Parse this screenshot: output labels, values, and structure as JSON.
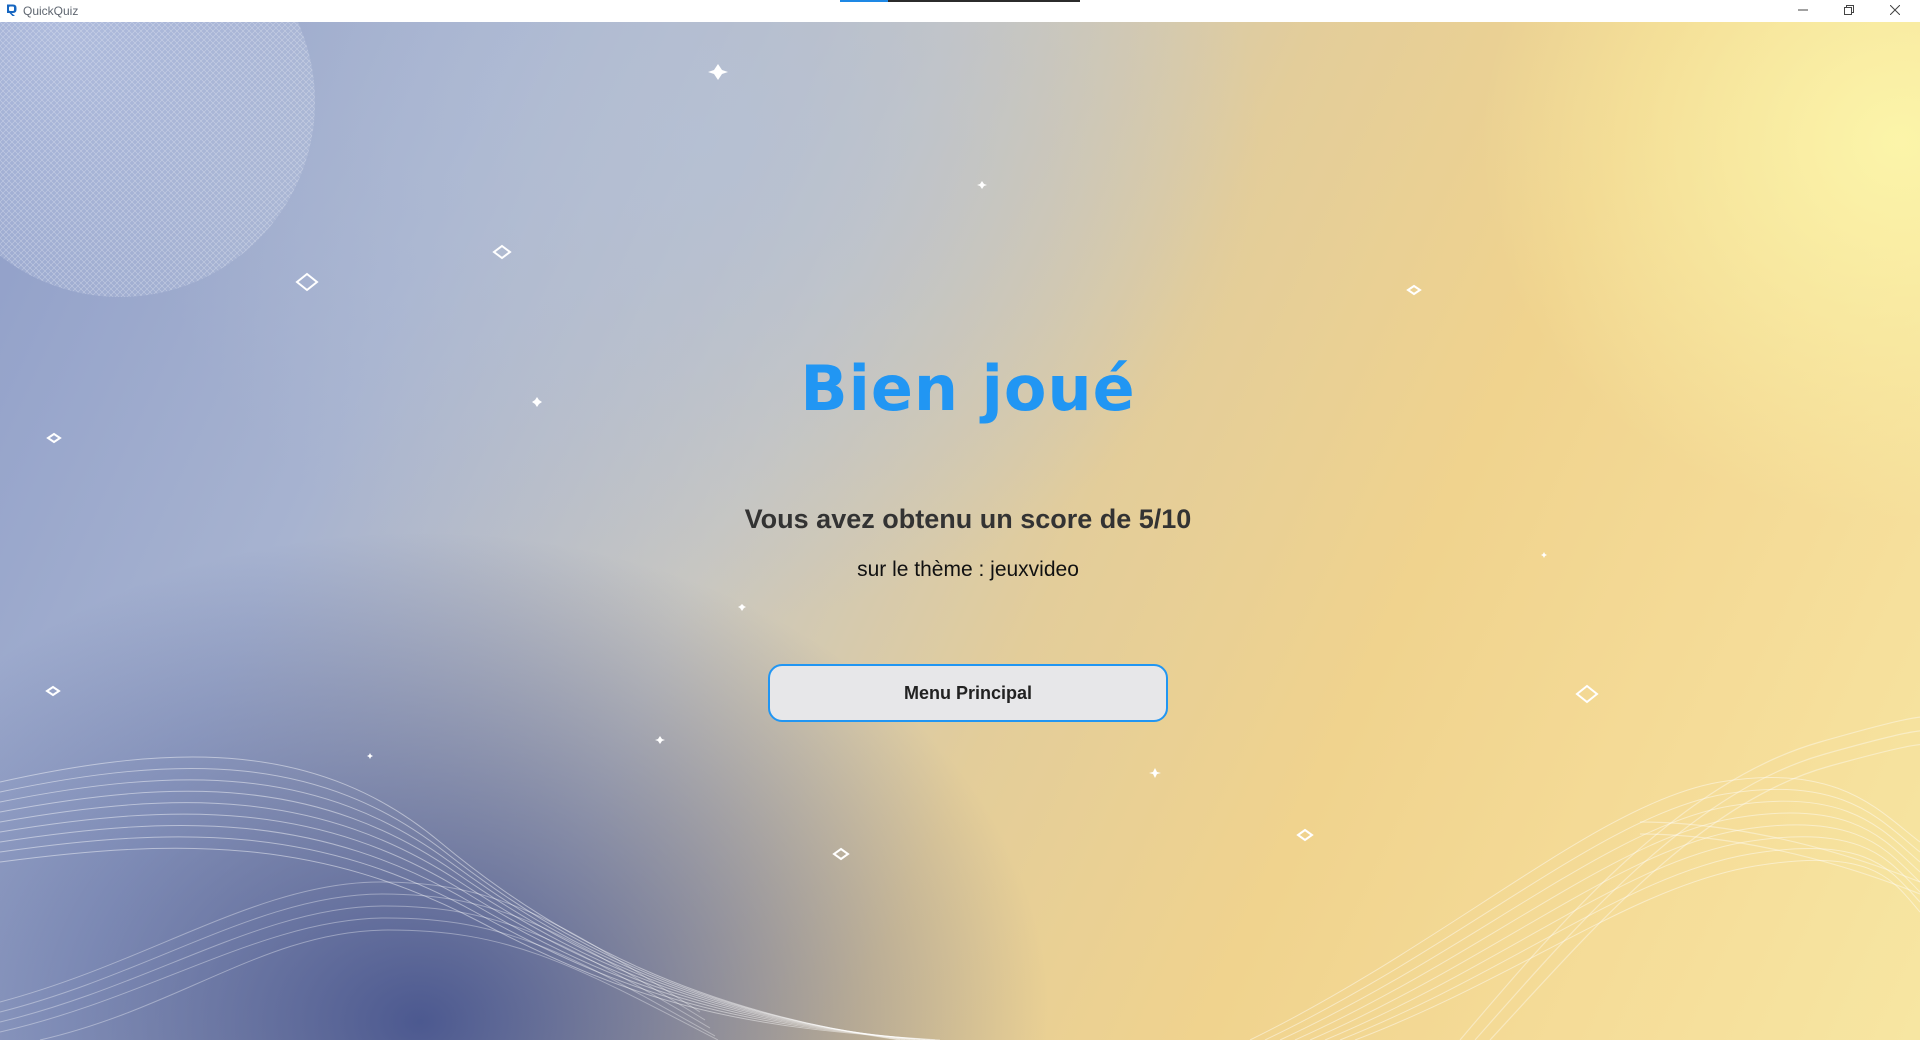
{
  "window": {
    "app_title": "QuickQuiz",
    "app_icon": "quickquiz-logo-icon",
    "controls": {
      "minimize_icon": "minimize-icon",
      "maximize_icon": "restore-icon",
      "close_icon": "close-icon"
    }
  },
  "result": {
    "title": "Bien joué",
    "score_text": "Vous avez obtenu un score de 5/10",
    "theme_text": "sur le thème : jeuxvideo",
    "menu_button_label": "Menu Principal"
  },
  "colors": {
    "accent": "#2196f3",
    "button_bg": "#e7e7e9",
    "score_text": "#333333"
  }
}
